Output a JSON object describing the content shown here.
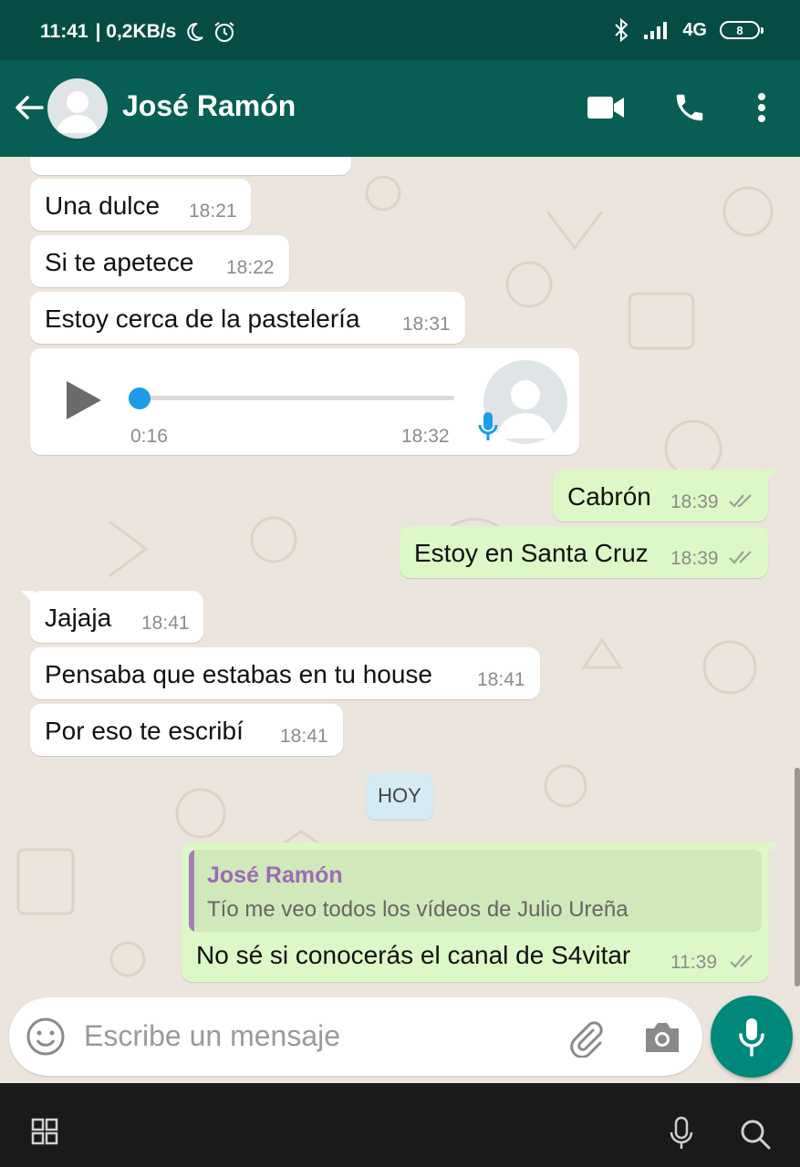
{
  "status_bar": {
    "time": "11:41",
    "network_speed": "| 0,2KB/s",
    "signal": "4G",
    "battery": "8"
  },
  "header": {
    "contact_name": "José Ramón"
  },
  "messages": [
    {
      "text": "Una dulce",
      "time": "18:21"
    },
    {
      "text": "Si te apetece",
      "time": "18:22"
    },
    {
      "text": "Estoy cerca de la pastelería",
      "time": "18:31"
    },
    {
      "duration": "0:16",
      "time": "18:32"
    },
    {
      "text": "Cabrón",
      "time": "18:39"
    },
    {
      "text": "Estoy en Santa Cruz",
      "time": "18:39"
    },
    {
      "text": "Jajaja",
      "time": "18:41"
    },
    {
      "text": "Pensaba que estabas en tu house",
      "time": "18:41"
    },
    {
      "text": "Por eso te escribí",
      "time": "18:41"
    },
    {
      "quote_name": "José Ramón",
      "quote_text": "Tío me veo todos los vídeos de Julio Ureña",
      "text": "No sé si conocerás el canal de S4vitar",
      "time": "11:39"
    }
  ],
  "date_chip": "HOY",
  "composer": {
    "placeholder": "Escribe un mensaje"
  },
  "colors": {
    "header": "#075E54",
    "status_bar": "#054D44",
    "outgoing_bubble": "#DCF8C6",
    "incoming_bubble": "#FFFFFF",
    "chat_bg": "#ECE5DD",
    "voice_accent": "#1E9BE9",
    "fab": "#00897B"
  }
}
